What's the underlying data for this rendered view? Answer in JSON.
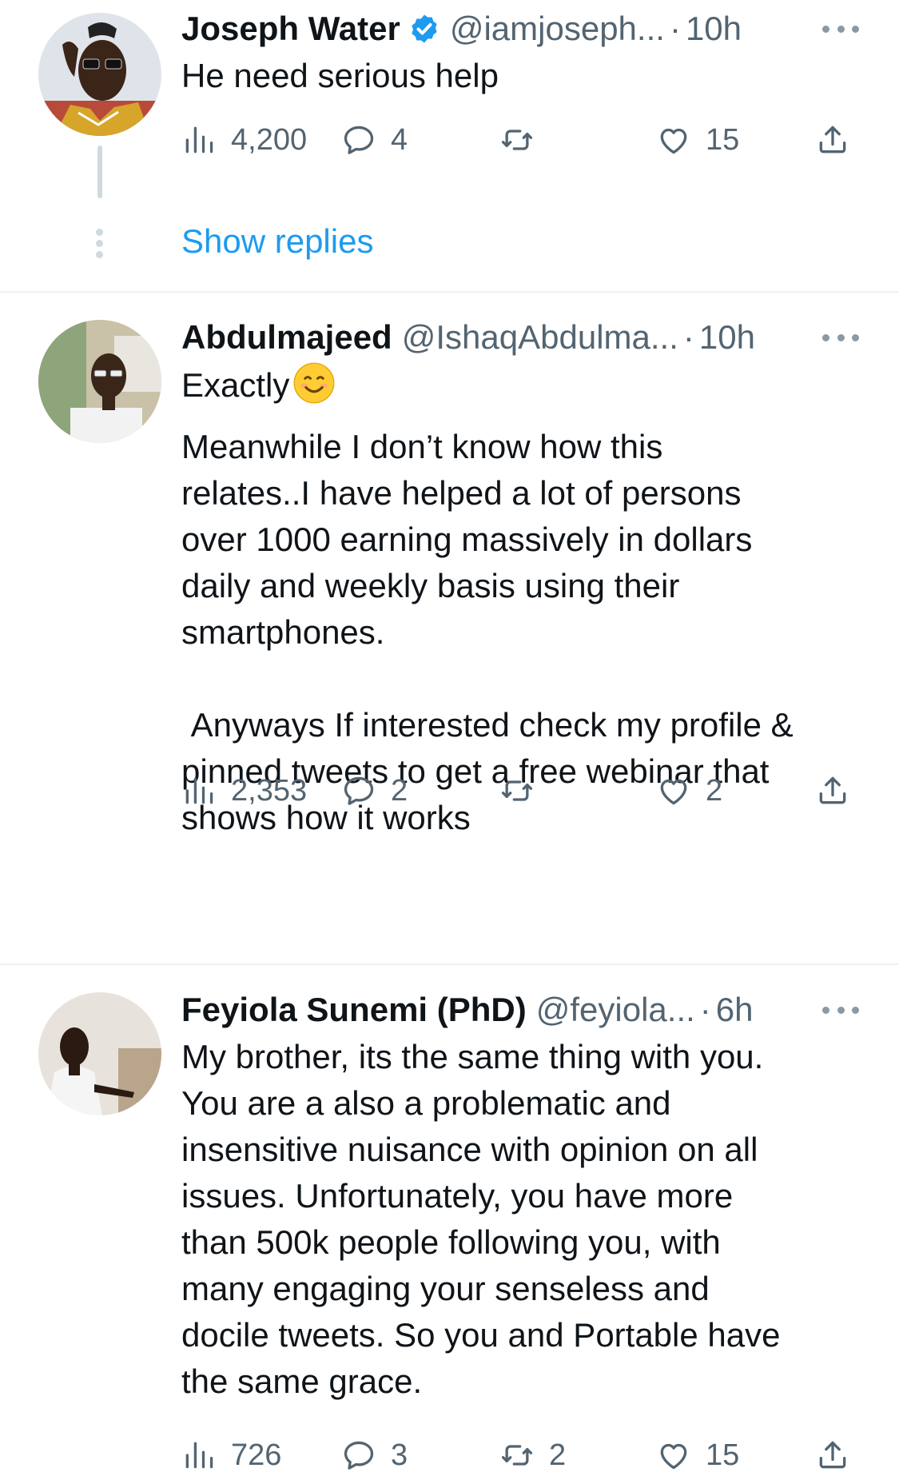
{
  "colors": {
    "link": "#1d9bf0",
    "muted": "#536471",
    "verified": "#1d9bf0",
    "divider": "#eff3f4"
  },
  "tweets": [
    {
      "name": "Joseph Water",
      "verified": true,
      "handle": "@iamjoseph...",
      "dot": "·",
      "time": "10h",
      "text": "He need serious help",
      "stats": {
        "views": "4,200",
        "replies": "4",
        "retweets": "",
        "likes": "15"
      },
      "show_replies": "Show replies"
    },
    {
      "name": "Abdulmajeed",
      "verified": false,
      "handle": "@IshaqAbdulma...",
      "dot": "·",
      "time": "10h",
      "text": "Exactly",
      "emoji": "smiling-face-emoji",
      "text_rest": "Meanwhile I don’t know how this\nrelates..I have helped a lot of persons\nover 1000 earning massively in dollars\ndaily and weekly basis using their\nsmartphones.\n\n Anyways If interested check my profile &\npinned tweets to get a free webinar that\nshows how it works",
      "stats": {
        "views": "2,353",
        "replies": "2",
        "retweets": "",
        "likes": "2"
      }
    },
    {
      "name": "Feyiola Sunemi (PhD)",
      "verified": false,
      "handle": "@feyiola...",
      "dot": "·",
      "time": "6h",
      "text": "My brother, its the same thing with you.\nYou are a also a problematic and\ninsensitive nuisance with opinion on all\nissues. Unfortunately, you have more\nthan 500k people following you, with\nmany engaging your senseless and\ndocile tweets. So you and Portable have\nthe same grace.",
      "stats": {
        "views": "726",
        "replies": "3",
        "retweets": "2",
        "likes": "15"
      }
    }
  ],
  "icons": [
    "views-icon",
    "reply-icon",
    "retweet-icon",
    "like-icon",
    "share-icon",
    "more-icon",
    "verified-badge-icon"
  ]
}
